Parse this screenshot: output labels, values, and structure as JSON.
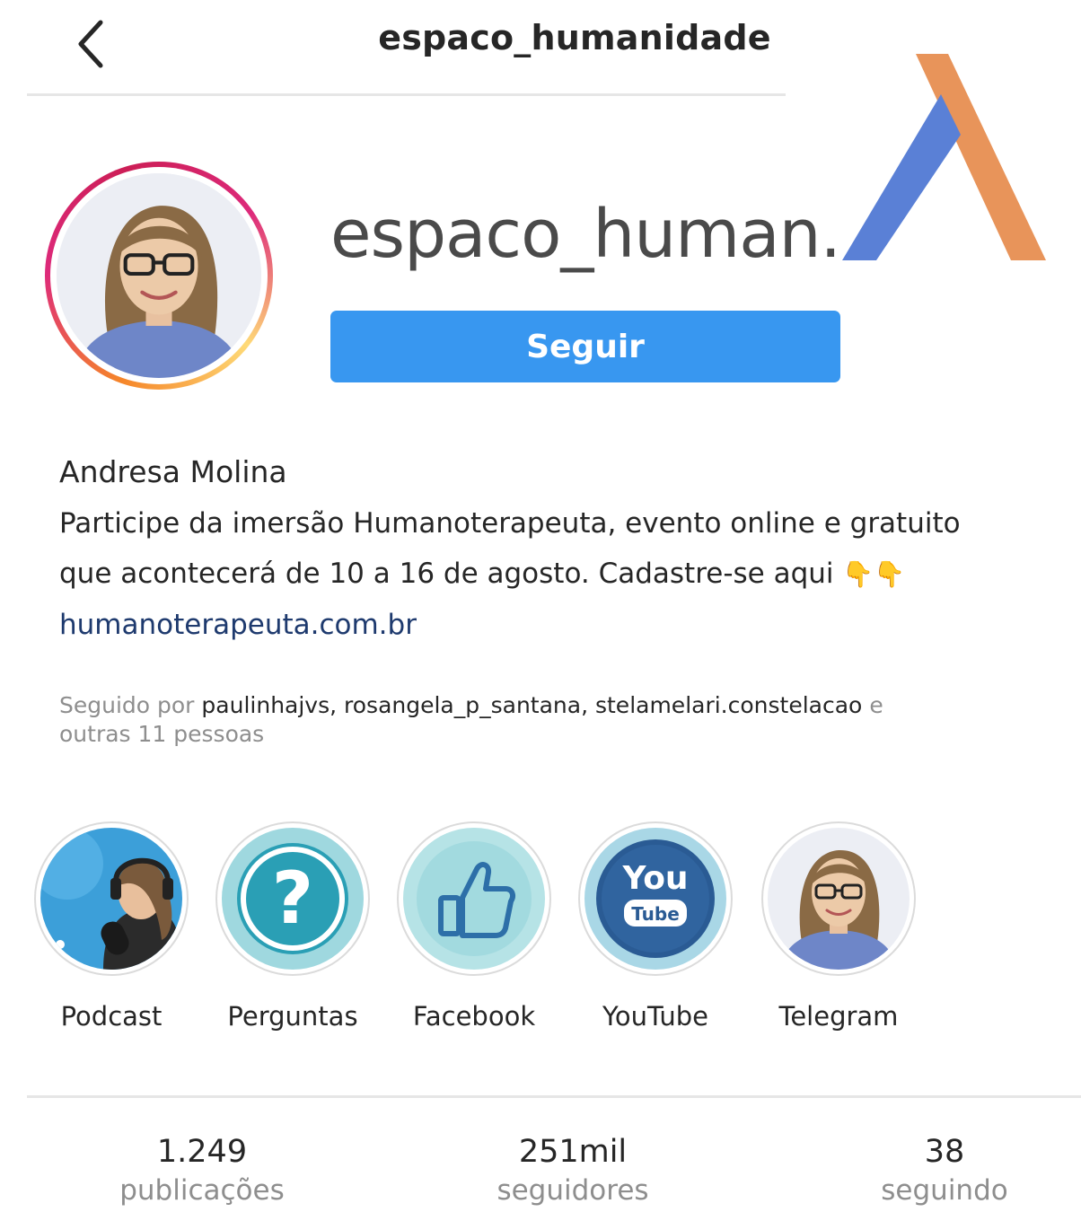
{
  "header": {
    "title": "espaco_humanidade"
  },
  "profile": {
    "username": "espaco_human.",
    "follow_label": "Seguir"
  },
  "bio": {
    "name": "Andresa Molina",
    "line1": "Participe da imersão Humanoterapeuta, evento online e gratuito",
    "line2": "que acontecerá de 10 a 16 de agosto. Cadastre-se aqui",
    "emoji": "👇👇",
    "link": "humanoterapeuta.com.br"
  },
  "followed_by": {
    "prefix": "Seguido por",
    "names": "paulinhajvs, rosangela_p_santana, stelamelari.constelacao",
    "suffix": "e",
    "others": "outras 11 pessoas"
  },
  "highlights": [
    {
      "label": "Podcast"
    },
    {
      "label": "Perguntas",
      "glyph": "?"
    },
    {
      "label": "Facebook"
    },
    {
      "label": "YouTube",
      "logo_top": "You",
      "logo_bottom": "Tube"
    },
    {
      "label": "Telegram"
    }
  ],
  "stats": [
    {
      "value": "1.249",
      "label": "publicações"
    },
    {
      "value": "251mil",
      "label": "seguidores"
    },
    {
      "value": "38",
      "label": "seguindo"
    }
  ],
  "colors": {
    "follow_button": "#3897f0",
    "logo_blue": "#5a80d6",
    "logo_orange": "#e8945a",
    "link": "#1e3a6e",
    "muted": "#8e8e8e"
  },
  "icons": {
    "back": "chevron-left-icon",
    "logo": "brand-logo-icon"
  }
}
